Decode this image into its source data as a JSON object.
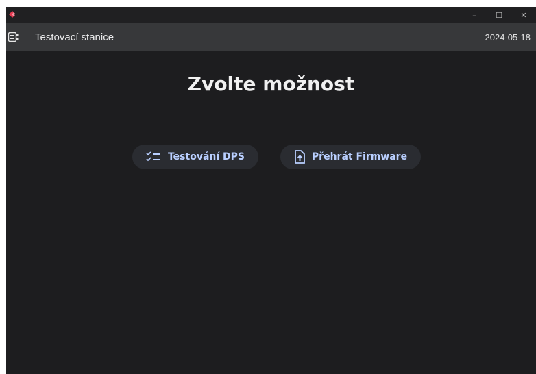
{
  "window": {
    "logo_icon": "app-logo-icon",
    "controls": {
      "minimize": "–",
      "maximize": "☐",
      "close": "✕"
    }
  },
  "appbar": {
    "menu_icon": "board-icon",
    "title": "Testovací stanice",
    "date": "2024-05-18"
  },
  "main": {
    "heading": "Zvolte možnost",
    "buttons": [
      {
        "label": "Testování DPS",
        "icon": "checklist-icon"
      },
      {
        "label": "Přehrát Firmware",
        "icon": "file-upload-icon"
      }
    ]
  },
  "colors": {
    "background": "#1d1d1f",
    "appbar": "#37383a",
    "button_bg": "#2a2c31",
    "button_text": "#b9cfff",
    "logo": "#e53950"
  }
}
